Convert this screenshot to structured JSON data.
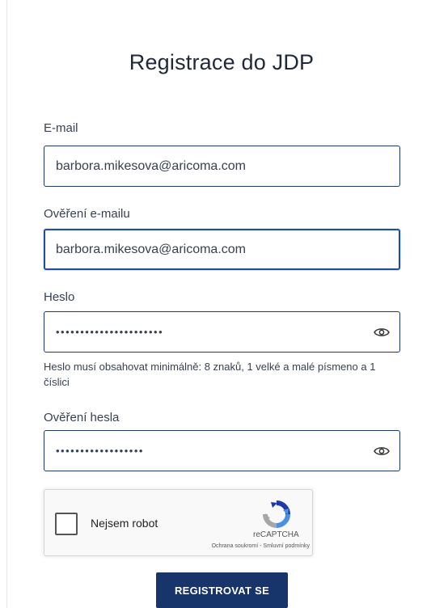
{
  "form": {
    "title": "Registrace do JDP",
    "email": {
      "label": "E-mail",
      "value": "barbora.mikesova@aricoma.com"
    },
    "email_confirm": {
      "label": "Ověření e-mailu",
      "value": "barbora.mikesova@aricoma.com"
    },
    "password": {
      "label": "Heslo",
      "value": "••••••••••••••••••••••",
      "icon": "eye-icon"
    },
    "password_hint": "Heslo musí obsahovat minimálně: 8 znaků, 1 velké a malé písmeno a 1 číslici",
    "password_confirm": {
      "label": "Ověření hesla",
      "value": "••••••••••••••••••",
      "icon": "eye-icon"
    },
    "recaptcha": {
      "label": "Nejsem robot",
      "brand": "reCAPTCHA",
      "terms": "Ochrana soukromí - Smluvní podmínky",
      "icon": "recaptcha-logo-icon"
    },
    "submit_label": "REGISTROVAT SE"
  },
  "colors": {
    "primary": "#17346b",
    "field_border": "#1e3a6d",
    "focus_border": "#1d4f9c"
  }
}
